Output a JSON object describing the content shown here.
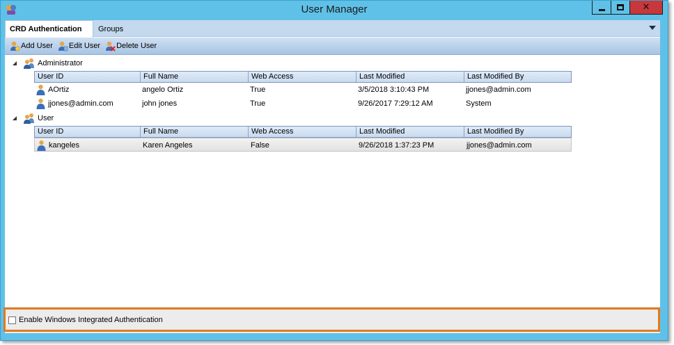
{
  "window": {
    "title": "User Manager",
    "minimize_glyph": "",
    "close_glyph": "✕"
  },
  "tabs": [
    {
      "label": "CRD Authentication",
      "active": true
    },
    {
      "label": "Groups",
      "active": false
    }
  ],
  "toolbar": {
    "add_label": "Add User",
    "edit_label": "Edit User",
    "delete_label": "Delete User"
  },
  "columns": [
    "User ID",
    "Full Name",
    "Web Access",
    "Last Modified",
    "Last Modified By"
  ],
  "groups": [
    {
      "name": "Administrator",
      "rows": [
        {
          "user_id": "AOrtiz",
          "full_name": "angelo Ortiz",
          "web_access": "True",
          "last_modified": "3/5/2018 3:10:43 PM",
          "last_modified_by": "jjones@admin.com"
        },
        {
          "user_id": "jjones@admin.com",
          "full_name": "john jones",
          "web_access": "True",
          "last_modified": "9/26/2017 7:29:12 AM",
          "last_modified_by": "System"
        }
      ]
    },
    {
      "name": "User",
      "rows": [
        {
          "user_id": "kangeles",
          "full_name": "Karen Angeles",
          "web_access": "False",
          "last_modified": "9/26/2018 1:37:23 PM",
          "last_modified_by": "jjones@admin.com",
          "selected": true
        }
      ]
    }
  ],
  "footer": {
    "checkbox_label": "Enable Windows Integrated Authentication",
    "checked": false
  },
  "colors": {
    "titlebar": "#5fc1e8",
    "close_button": "#c7373c",
    "highlight_border": "#e07b1f",
    "toolbar_gradient_top": "#cfe0f3",
    "toolbar_gradient_bottom": "#a8c4e3"
  }
}
